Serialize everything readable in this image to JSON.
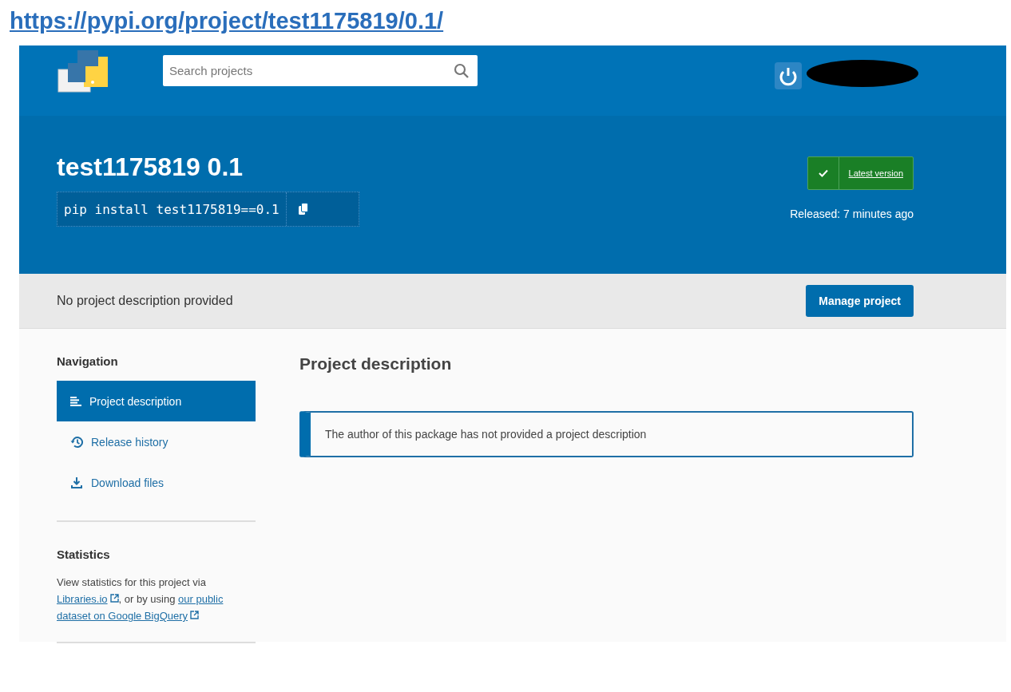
{
  "url": "https://pypi.org/project/test1175819/0.1/",
  "header": {
    "search": {
      "placeholder": "Search projects"
    }
  },
  "package": {
    "title": "test1175819 0.1",
    "install_command": "pip install test1175819==0.1",
    "latest_badge": "Latest version",
    "released": "Released: 7 minutes ago"
  },
  "summary_bar": {
    "text": "No project description provided",
    "button": "Manage project"
  },
  "sidebar": {
    "heading": "Navigation",
    "items": [
      {
        "label": "Project description",
        "kind": "description",
        "selected": true
      },
      {
        "label": "Release history",
        "kind": "history",
        "selected": false
      },
      {
        "label": "Download files",
        "kind": "download",
        "selected": false
      }
    ],
    "statistics": {
      "heading": "Statistics",
      "text": "View statistics for this project via",
      "link_1": "Libraries.io",
      "middle": ", or by using",
      "link_2_line_1": "our public",
      "link_2_line_2": "dataset on Google BigQuery"
    }
  },
  "main": {
    "heading": "Project description",
    "notice": "The author of this package has not provided a project description"
  }
}
